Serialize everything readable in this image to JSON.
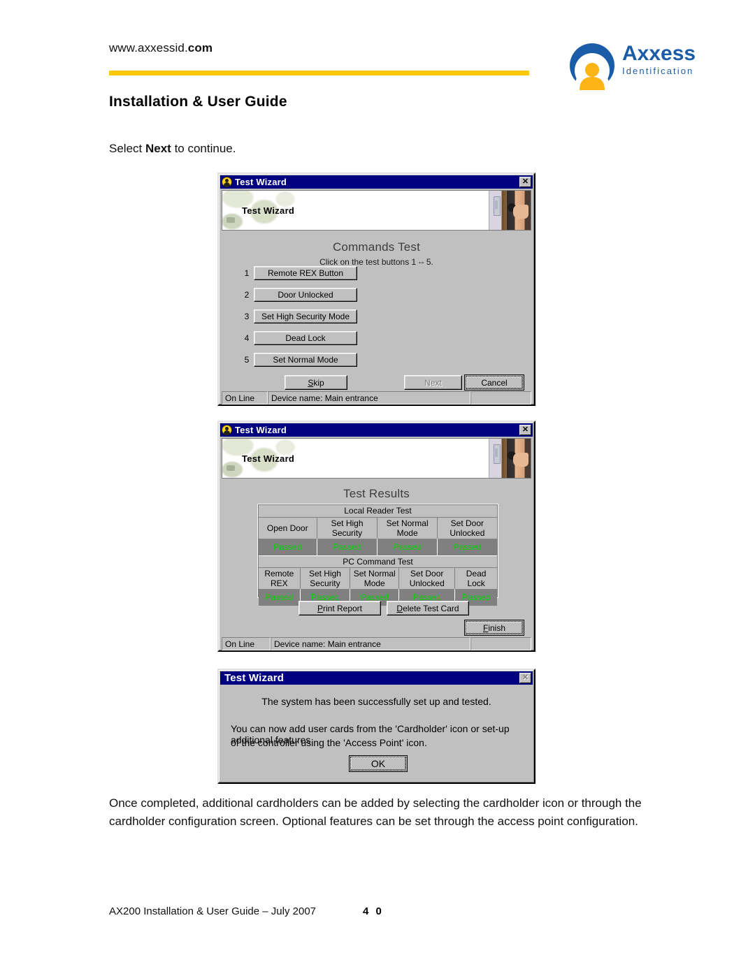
{
  "header": {
    "site_url_plain": "www.axxessid.",
    "site_url_bold": "com",
    "doc_title": "Installation & User Guide",
    "rule_color": "#fdc70c",
    "logo": {
      "wordmark": "Axxess",
      "tagline": "Identification",
      "brand_color": "#1a5ca8",
      "accent_color": "#fcb316"
    }
  },
  "intro": {
    "before": "Select ",
    "bold": "Next",
    "after": " to continue."
  },
  "dialog_commands": {
    "title": "Test Wizard",
    "close_label": "✕",
    "banner_title": "Test Wizard",
    "heading": "Commands Test",
    "subheading": "Click on the test buttons 1 -- 5.",
    "tests": [
      {
        "num": "1",
        "label": "Remote REX Button"
      },
      {
        "num": "2",
        "label": "Door Unlocked"
      },
      {
        "num": "3",
        "label": "Set High Security Mode"
      },
      {
        "num": "4",
        "label": "Dead Lock"
      },
      {
        "num": "5",
        "label": "Set Normal Mode"
      }
    ],
    "skip_label": "Skip",
    "skip_accel": "S",
    "next_label": "Next",
    "cancel_label": "Cancel",
    "status_left": "On Line",
    "status_center": "Device name: Main entrance",
    "status_right": ""
  },
  "dialog_results": {
    "title": "Test Wizard",
    "close_label": "✕",
    "banner_title": "Test Wizard",
    "heading": "Test Results",
    "sections": [
      {
        "title": "Local Reader Test",
        "columns": [
          "Open Door",
          "Set High Security",
          "Set Normal Mode",
          "Set Door Unlocked"
        ],
        "results": [
          "Passed",
          "Passed",
          "Passed",
          "Passed"
        ],
        "widths": [
          24.5,
          25.5,
          25,
          25
        ]
      },
      {
        "title": "PC Command Test",
        "columns": [
          "Remote REX",
          "Set High Security",
          "Set Normal Mode",
          "Set Door Unlocked",
          "Dead Lock"
        ],
        "results": [
          "Passed",
          "Passed",
          "Passed",
          "Passed",
          "Passed"
        ],
        "widths": [
          17.5,
          21,
          20.5,
          23.5,
          17.5
        ]
      }
    ],
    "pass_color": "#00d400",
    "print_label": "Print Report",
    "delete_label": "Delete Test Card",
    "finish_label": "Finish",
    "status_left": "On Line",
    "status_center": "Device name: Main entrance",
    "status_right": ""
  },
  "dialog_done": {
    "title": "Test Wizard",
    "close_label": "✕",
    "line1": "The system has been successfully set up and tested.",
    "line2": "You can now add user cards from the 'Cardholder' icon or set-up additional features",
    "line3": "of the controller using the 'Access Point' icon.",
    "ok_label": "OK"
  },
  "closing_paragraph": "Once completed, additional cardholders can be added by selecting the cardholder icon or through the cardholder configuration screen.  Optional features can be set through the access point configuration.",
  "footer": {
    "text": "AX200 Installation & User Guide – July 2007",
    "page": "4 0"
  }
}
